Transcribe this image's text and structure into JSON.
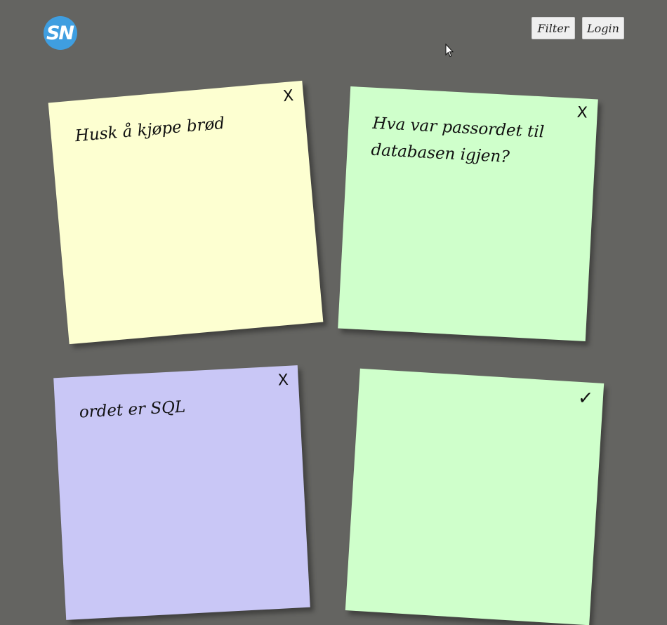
{
  "header": {
    "logo_text": "SN",
    "logo_color": "#3f9ee0",
    "buttons": {
      "filter_label": "Filter",
      "login_label": "Login"
    }
  },
  "notes": [
    {
      "text": "Husk å kjøpe brød",
      "action": "X",
      "color": "#fdffd1"
    },
    {
      "text": "Hva var passordet til databasen igjen?",
      "action": "X",
      "color": "#cfffcb"
    },
    {
      "text": "ordet er SQL",
      "action": "X",
      "color": "#c9c7f6"
    },
    {
      "text": "",
      "action": "✓",
      "color": "#cfffcb"
    }
  ],
  "colors": {
    "background": "#646461"
  },
  "cursor_icon": "arrow-cursor-icon"
}
